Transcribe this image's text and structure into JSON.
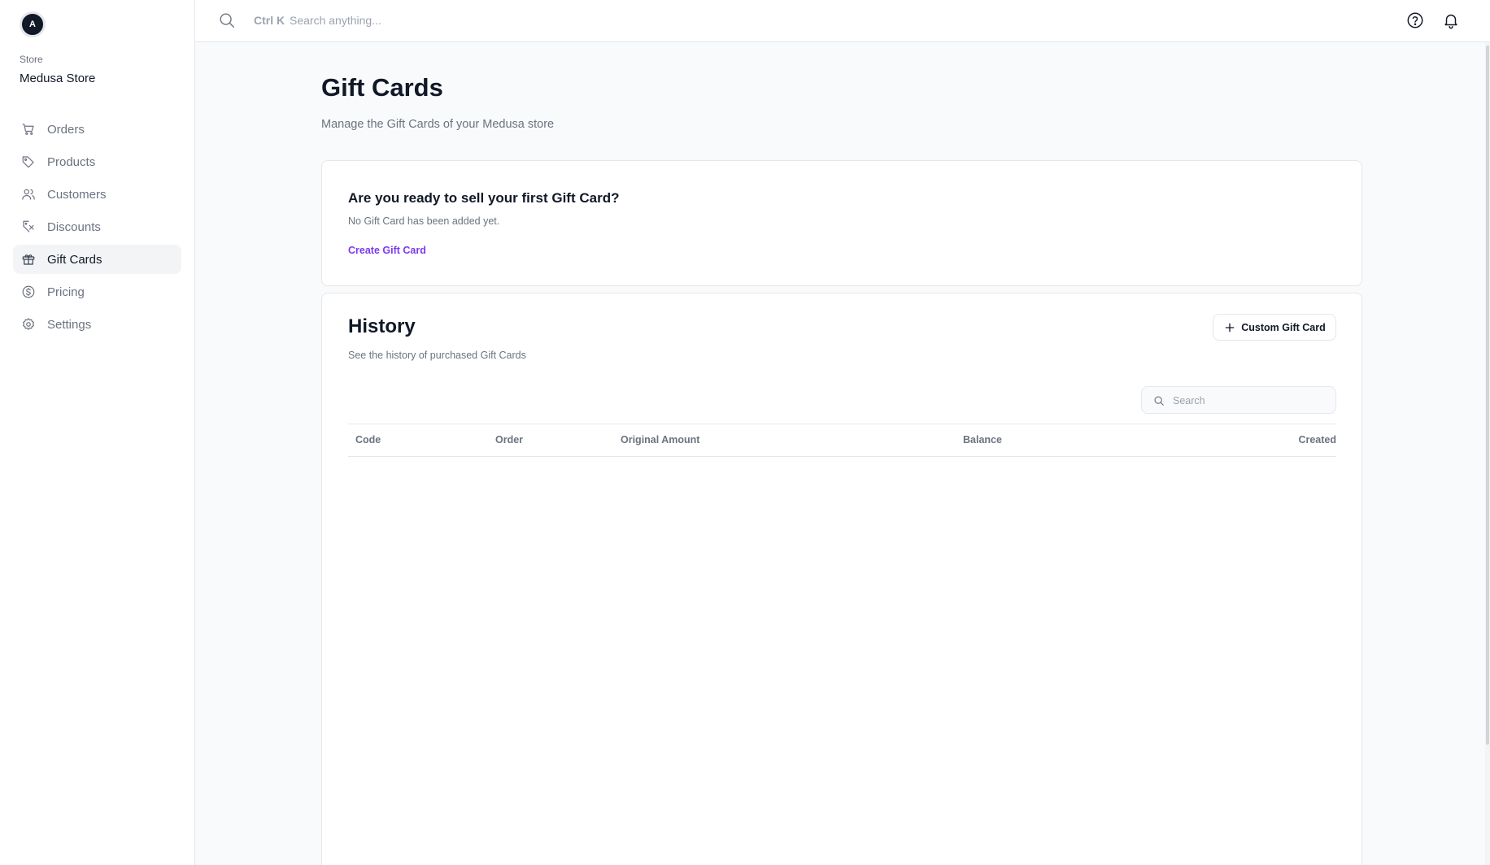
{
  "sidebar": {
    "avatar_initial": "A",
    "store_label": "Store",
    "store_name": "Medusa Store",
    "items": [
      {
        "label": "Orders",
        "icon": "cart-icon",
        "active": false
      },
      {
        "label": "Products",
        "icon": "tag-icon",
        "active": false
      },
      {
        "label": "Customers",
        "icon": "users-icon",
        "active": false
      },
      {
        "label": "Discounts",
        "icon": "discount-icon",
        "active": false
      },
      {
        "label": "Gift Cards",
        "icon": "gift-icon",
        "active": true
      },
      {
        "label": "Pricing",
        "icon": "dollar-icon",
        "active": false
      },
      {
        "label": "Settings",
        "icon": "gear-icon",
        "active": false
      }
    ]
  },
  "topbar": {
    "shortcut": "Ctrl K",
    "search_placeholder": "Search anything..."
  },
  "page": {
    "title": "Gift Cards",
    "subtitle": "Manage the Gift Cards of your Medusa store"
  },
  "empty_state": {
    "heading": "Are you ready to sell your first Gift Card?",
    "subtext": "No Gift Card has been added yet.",
    "action_label": "Create Gift Card"
  },
  "history": {
    "title": "History",
    "subtitle": "See the history of purchased Gift Cards",
    "button_label": "Custom Gift Card",
    "search_placeholder": "Search",
    "columns": [
      "Code",
      "Order",
      "Original Amount",
      "Balance",
      "Created"
    ],
    "rows": []
  },
  "colors": {
    "accent": "#7c3aed",
    "text_primary": "#111827",
    "text_muted": "#6b7280",
    "border": "#e5e7eb",
    "background": "#f9fafb"
  }
}
